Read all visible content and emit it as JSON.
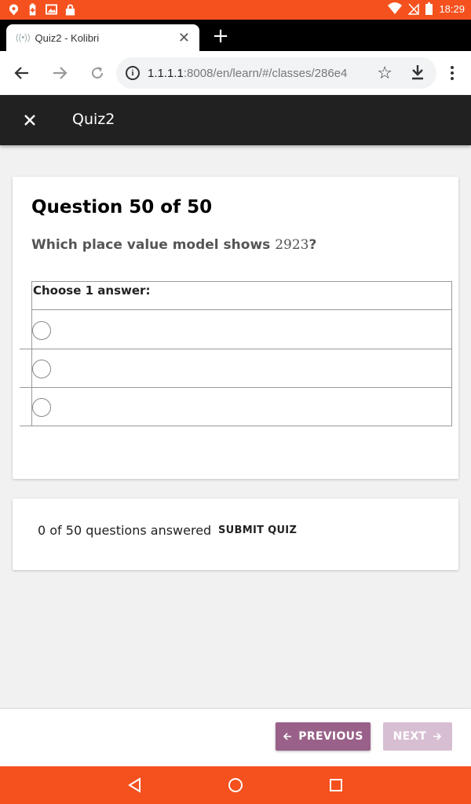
{
  "status_bar": {
    "time": "18:29",
    "left_icons": [
      "location-pin-icon",
      "battery-saver-icon",
      "image-icon",
      "lock-icon"
    ],
    "right_icons": [
      "wifi-icon",
      "no-signal-icon",
      "battery-icon"
    ]
  },
  "browser": {
    "tab": {
      "title": "Quiz2 - Kolibri",
      "favicon": "kolibri-favicon-icon"
    },
    "url_host": "1.1.1.1",
    "url_rest": ":8008/en/learn/#/classes/286e4"
  },
  "app_bar": {
    "title": "Quiz2"
  },
  "question": {
    "heading": "Question 50 of 50",
    "text_before": "Which place value model shows ",
    "number": "2923",
    "text_after": "?",
    "choose_label": "Choose 1 answer:",
    "choices": [
      "",
      "",
      ""
    ]
  },
  "progress": {
    "answered_text": "0 of 50 questions answered",
    "submit_label": "SUBMIT QUIZ"
  },
  "navigation": {
    "previous_label": "PREVIOUS",
    "next_label": "NEXT"
  },
  "colors": {
    "status_bar": "#f4511e",
    "app_bar": "#212121",
    "primary_button": "#996189",
    "disabled_button": "#d8bed2"
  }
}
